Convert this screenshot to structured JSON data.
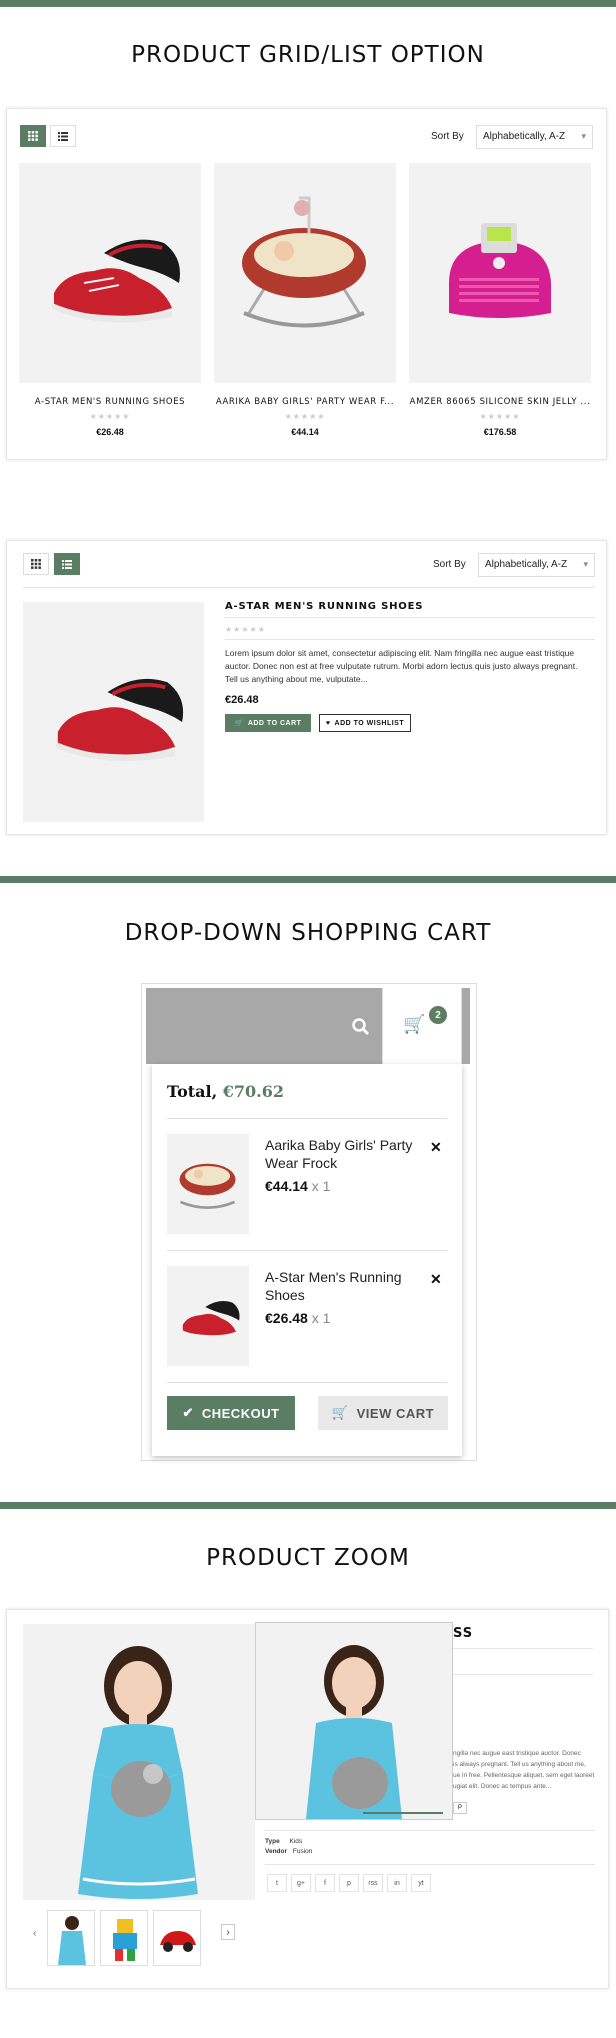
{
  "sections": {
    "grid_title": "PRODUCT GRID/LIST OPTION",
    "cart_title": "DROP-DOWN SHOPPING CART",
    "zoom_title": "PRODUCT ZOOM"
  },
  "toolbar": {
    "sort_label": "Sort By",
    "sort_value": "Alphabetically, A-Z",
    "grid_icon": "grid-icon",
    "list_icon": "list-icon"
  },
  "grid_products": [
    {
      "name": "A-STAR MEN'S RUNNING SHOES",
      "price": "€26.48",
      "rating": "★★★★★"
    },
    {
      "name": "AARIKA BABY GIRLS' PARTY WEAR F...",
      "price": "€44.14",
      "rating": "★★★★★"
    },
    {
      "name": "AMZER 86065 SILICONE SKIN JELLY ...",
      "price": "€176.58",
      "rating": "★★★★★"
    }
  ],
  "list_product": {
    "name": "A-STAR MEN'S RUNNING SHOES",
    "rating": "★★★★★",
    "description": "Lorem ipsum dolor sit amet, consectetur adipiscing elit. Nam fringilla nec augue east tristique auctor. Donec non est at free vulputate rutrum. Morbi adorn lectus quis justo always pregnant. Tell us anything about me, vulputate...",
    "price": "€26.48",
    "add_to_cart": "ADD TO CART",
    "add_to_wishlist": "ADD TO WISHLIST"
  },
  "cart": {
    "badge_count": "2",
    "total_label": "Total,",
    "total_value": "€70.62",
    "items": [
      {
        "name": "Aarika Baby Girls' Party Wear Frock",
        "price": "€44.14",
        "qty": "x 1"
      },
      {
        "name": "A-Star Men's Running Shoes",
        "price": "€26.48",
        "qty": "x 1"
      }
    ],
    "checkout_label": "CHECKOUT",
    "view_cart_label": "VIEW CART"
  },
  "zoom": {
    "title_fragment": "SS",
    "desc_lines": [
      "ngilla nec augue east tristique auctor. Donec",
      "is always pregnant. Tell us anything about me,",
      "ue in free. Pellentesque aliquet, sem eget laoreet",
      "ugiat elit. Donec ac tempus ante..."
    ],
    "type_label": "Type",
    "type_value": "Kids",
    "vendor_label": "Vendor",
    "vendor_value": "Fusion",
    "social_icons": [
      "twitter-icon",
      "google-plus-icon",
      "facebook-icon",
      "pinterest-icon",
      "rss-icon",
      "linkedin-icon",
      "youtube-icon"
    ],
    "social_glyphs": [
      "t",
      "g+",
      "f",
      "p",
      "rss",
      "in",
      "yt"
    ]
  },
  "colors": {
    "accent": "#5a7d63",
    "image_bg": "#f2f2f2",
    "header_gray": "#a8a8a8"
  }
}
